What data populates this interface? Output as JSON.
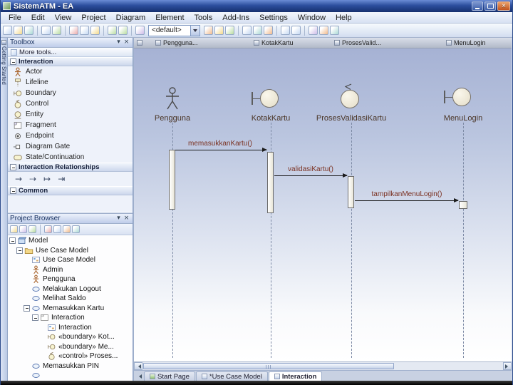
{
  "window": {
    "title": "SistemATM - EA"
  },
  "glyphs": {
    "close": "×",
    "chevron_down": "▾"
  },
  "menu": {
    "items": [
      "File",
      "Edit",
      "View",
      "Project",
      "Diagram",
      "Element",
      "Tools",
      "Add-Ins",
      "Settings",
      "Window",
      "Help"
    ]
  },
  "toolbar": {
    "diagram_style_dropdown": "<default>"
  },
  "side_tab": {
    "label": "Getting Started"
  },
  "toolbox": {
    "title": "Toolbox",
    "more_tools": "More tools...",
    "sections": {
      "interaction": {
        "title": "Interaction",
        "items": [
          "Actor",
          "Lifeline",
          "Boundary",
          "Control",
          "Entity",
          "Fragment",
          "Endpoint",
          "Diagram Gate",
          "State/Continuation"
        ]
      },
      "relationships": {
        "title": "Interaction Relationships",
        "glyphs": [
          "→",
          "⇢",
          "↦",
          "⇥"
        ]
      },
      "common": {
        "title": "Common"
      }
    }
  },
  "project_browser": {
    "title": "Project Browser",
    "tree": [
      {
        "label": "Model"
      },
      {
        "label": "Use Case Model"
      },
      {
        "label": "Use Case Model"
      },
      {
        "label": "Admin"
      },
      {
        "label": "Pengguna"
      },
      {
        "label": "Melakukan Logout"
      },
      {
        "label": "Melihat Saldo"
      },
      {
        "label": "Memasukkan Kartu"
      },
      {
        "label": "Interaction"
      },
      {
        "label": "Interaction"
      },
      {
        "label": "«boundary» Kot..."
      },
      {
        "label": "«boundary» Me..."
      },
      {
        "label": "«control» Proses..."
      },
      {
        "label": "Memasukkan PIN"
      },
      {
        "label": ""
      }
    ]
  },
  "diagram": {
    "header": {
      "lifelines": [
        "Pengguna...",
        "KotakKartu",
        "ProsesValid...",
        "MenuLogin"
      ]
    },
    "lifelines": [
      {
        "name": "Pengguna",
        "type": "actor"
      },
      {
        "name": "KotakKartu",
        "type": "boundary"
      },
      {
        "name": "ProsesValidasiKartu",
        "type": "control"
      },
      {
        "name": "MenuLogin",
        "type": "boundary"
      }
    ],
    "messages": [
      {
        "label": "memasukkanKartu()",
        "from": "Pengguna",
        "to": "KotakKartu"
      },
      {
        "label": "validasiKartu()",
        "from": "KotakKartu",
        "to": "ProsesValidasiKartu"
      },
      {
        "label": "tampilkanMenuLogin()",
        "from": "ProsesValidasiKartu",
        "to": "MenuLogin"
      }
    ]
  },
  "tabs": {
    "items": [
      "Start Page",
      "*Use Case Model",
      "Interaction"
    ],
    "active": "Interaction"
  }
}
